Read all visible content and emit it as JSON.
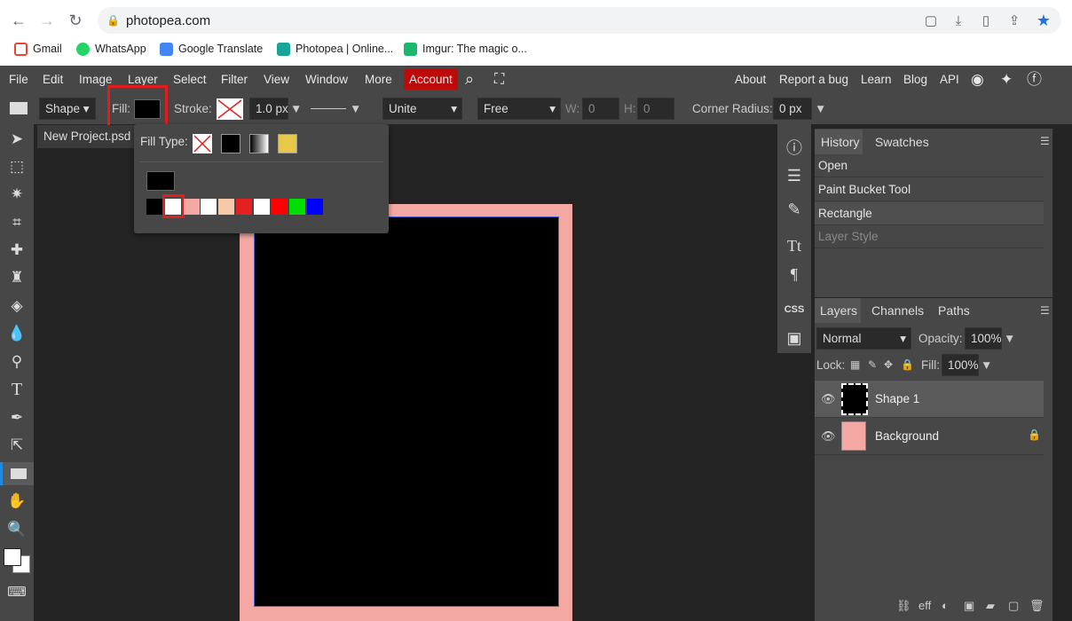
{
  "browser": {
    "url": "photopea.com",
    "bookmarks": [
      {
        "label": "Gmail",
        "icon": "gmail-icon",
        "color": "#ea4335"
      },
      {
        "label": "WhatsApp",
        "icon": "whatsapp-icon",
        "color": "#25d366"
      },
      {
        "label": "Google Translate",
        "icon": "translate-icon",
        "color": "#4285f4"
      },
      {
        "label": "Photopea | Online...",
        "icon": "photopea-icon",
        "color": "#18a497"
      },
      {
        "label": "Imgur: The magic o...",
        "icon": "imgur-icon",
        "color": "#1bb76e"
      }
    ]
  },
  "menu": {
    "items": [
      "File",
      "Edit",
      "Image",
      "Layer",
      "Select",
      "Filter",
      "View",
      "Window",
      "More"
    ],
    "account": "Account",
    "right": [
      "About",
      "Report a bug",
      "Learn",
      "Blog",
      "API"
    ]
  },
  "options": {
    "mode": "Shape",
    "fill_label": "Fill:",
    "stroke_label": "Stroke:",
    "stroke_width": "1.0 px",
    "combine": "Unite",
    "size_mode": "Free",
    "w_label": "W:",
    "w_value": "0",
    "h_label": "H:",
    "h_value": "0",
    "corner_label": "Corner Radius:",
    "corner_value": "0 px"
  },
  "document": {
    "tab": "New Project.psd"
  },
  "fill_popup": {
    "type_label": "Fill Type:",
    "swatches": [
      "#000000",
      "#ffffff",
      "#f4a8a3",
      "#ffffff",
      "#f5c9a7",
      "#e52020",
      "#ffffff",
      "#ff0000",
      "#00dd00",
      "#0000ff"
    ]
  },
  "history": {
    "tabs": [
      "History",
      "Swatches"
    ],
    "items": [
      "Open",
      "Paint Bucket Tool",
      "Rectangle",
      "Layer Style"
    ]
  },
  "layers": {
    "tabs": [
      "Layers",
      "Channels",
      "Paths"
    ],
    "blend": "Normal",
    "opacity_label": "Opacity:",
    "opacity": "100%",
    "lock_label": "Lock:",
    "fill_label": "Fill:",
    "fill": "100%",
    "items": [
      {
        "name": "Shape 1"
      },
      {
        "name": "Background"
      }
    ]
  },
  "colors": {
    "accent": "#bd0b0b",
    "canvas_bg": "#f4a8a3",
    "shape_fill": "#000000"
  }
}
